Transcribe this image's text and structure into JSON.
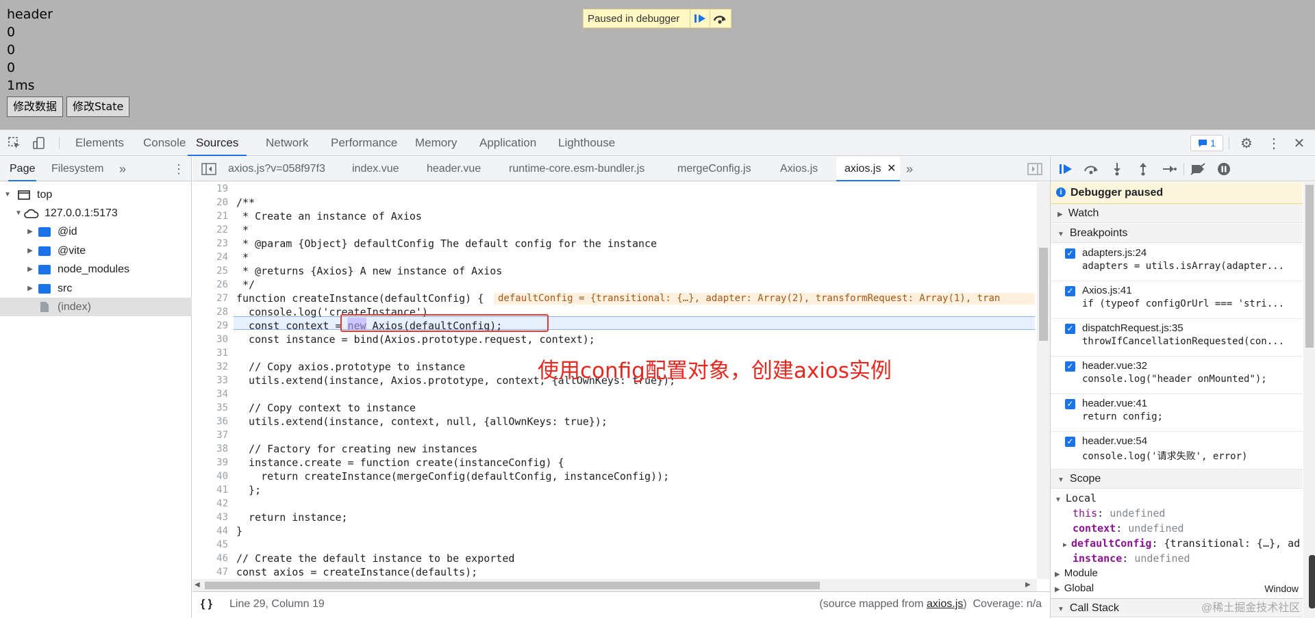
{
  "page": {
    "lines": [
      "header",
      "0",
      "0",
      "0",
      "1ms"
    ],
    "buttons": [
      "修改数据",
      "修改State"
    ],
    "paused_text": "Paused in debugger"
  },
  "devtools": {
    "tabs": [
      "Elements",
      "Console",
      "Sources",
      "Network",
      "Performance",
      "Memory",
      "Application",
      "Lighthouse"
    ],
    "active_tab": "Sources",
    "issues_count": "1"
  },
  "navigator": {
    "tabs": [
      "Page",
      "Filesystem"
    ],
    "tree": [
      {
        "label": "top",
        "icon": "frame-icon"
      },
      {
        "label": "127.0.0.1:5173",
        "icon": "cloud-icon"
      },
      {
        "label": "@id",
        "icon": "folder-icon"
      },
      {
        "label": "@vite",
        "icon": "folder-icon"
      },
      {
        "label": "node_modules",
        "icon": "folder-icon"
      },
      {
        "label": "src",
        "icon": "folder-icon"
      },
      {
        "label": "(index)",
        "icon": "file-icon"
      }
    ]
  },
  "editor": {
    "file_tabs": [
      "axios.js?v=058f97f3",
      "index.vue",
      "header.vue",
      "runtime-core.esm-bundler.js",
      "mergeConfig.js",
      "Axios.js",
      "axios.js"
    ],
    "active_file": "axios.js",
    "lines": [
      {
        "n": "19",
        "t": ""
      },
      {
        "n": "20",
        "t": "/**"
      },
      {
        "n": "21",
        "t": " * Create an instance of Axios"
      },
      {
        "n": "22",
        "t": " *"
      },
      {
        "n": "23",
        "t": " * @param {Object} defaultConfig The default config for the instance"
      },
      {
        "n": "24",
        "t": " *"
      },
      {
        "n": "25",
        "t": " * @returns {Axios} A new instance of Axios"
      },
      {
        "n": "26",
        "t": " */"
      },
      {
        "n": "27",
        "t": "function createInstance(defaultConfig) {"
      },
      {
        "n": "28",
        "t": "  console.log('createInstance')"
      },
      {
        "n": "29",
        "t": "  const context = new Axios(defaultConfig);"
      },
      {
        "n": "30",
        "t": "  const instance = bind(Axios.prototype.request, context);"
      },
      {
        "n": "31",
        "t": ""
      },
      {
        "n": "32",
        "t": "  // Copy axios.prototype to instance"
      },
      {
        "n": "33",
        "t": "  utils.extend(instance, Axios.prototype, context, {allOwnKeys: true});"
      },
      {
        "n": "34",
        "t": ""
      },
      {
        "n": "35",
        "t": "  // Copy context to instance"
      },
      {
        "n": "36",
        "t": "  utils.extend(instance, context, null, {allOwnKeys: true});"
      },
      {
        "n": "37",
        "t": ""
      },
      {
        "n": "38",
        "t": "  // Factory for creating new instances"
      },
      {
        "n": "39",
        "t": "  instance.create = function create(instanceConfig) {"
      },
      {
        "n": "40",
        "t": "    return createInstance(mergeConfig(defaultConfig, instanceConfig));"
      },
      {
        "n": "41",
        "t": "  };"
      },
      {
        "n": "42",
        "t": ""
      },
      {
        "n": "43",
        "t": "  return instance;"
      },
      {
        "n": "44",
        "t": "}"
      },
      {
        "n": "45",
        "t": ""
      },
      {
        "n": "46",
        "t": "// Create the default instance to be exported"
      },
      {
        "n": "47",
        "t": "const axios = createInstance(defaults);"
      }
    ],
    "inline_value": "defaultConfig = {transitional: {…}, adapter: Array(2), transformRequest: Array(1), tran",
    "annotation": "使用config配置对象，创建axios实例",
    "status_position": "Line 29, Column 19",
    "source_mapped_prefix": "(source mapped from ",
    "source_mapped_file": "axios.js",
    "source_mapped_suffix": ")",
    "coverage": "Coverage: n/a"
  },
  "debugger": {
    "paused_label": "Debugger paused",
    "sections": {
      "watch": "Watch",
      "breakpoints": "Breakpoints",
      "scope": "Scope",
      "call_stack": "Call Stack"
    },
    "breakpoints": [
      {
        "file": "adapters.js:24",
        "code": "adapters = utils.isArray(adapter..."
      },
      {
        "file": "Axios.js:41",
        "code": "if (typeof configOrUrl === 'stri..."
      },
      {
        "file": "dispatchRequest.js:35",
        "code": "throwIfCancellationRequested(con..."
      },
      {
        "file": "header.vue:32",
        "code": "console.log(\"header onMounted\");"
      },
      {
        "file": "header.vue:41",
        "code": "return config;"
      },
      {
        "file": "header.vue:54",
        "code": "console.log('请求失败', error)"
      }
    ],
    "scope": {
      "local": "Local",
      "vars": [
        {
          "name": "this",
          "value": "undefined"
        },
        {
          "name": "context",
          "value": "undefined"
        },
        {
          "name": "defaultConfig",
          "value": "{transitional: {…}, ad"
        },
        {
          "name": "instance",
          "value": "undefined"
        }
      ],
      "module": "Module",
      "global": "Global",
      "global_value": "Window"
    }
  },
  "watermark": "@稀土掘金技术社区",
  "colors": {
    "accent": "#1a73e8",
    "annotation": "#e8271f",
    "highlight_box": "#e53935",
    "execution_line": "#e8f0fe"
  }
}
